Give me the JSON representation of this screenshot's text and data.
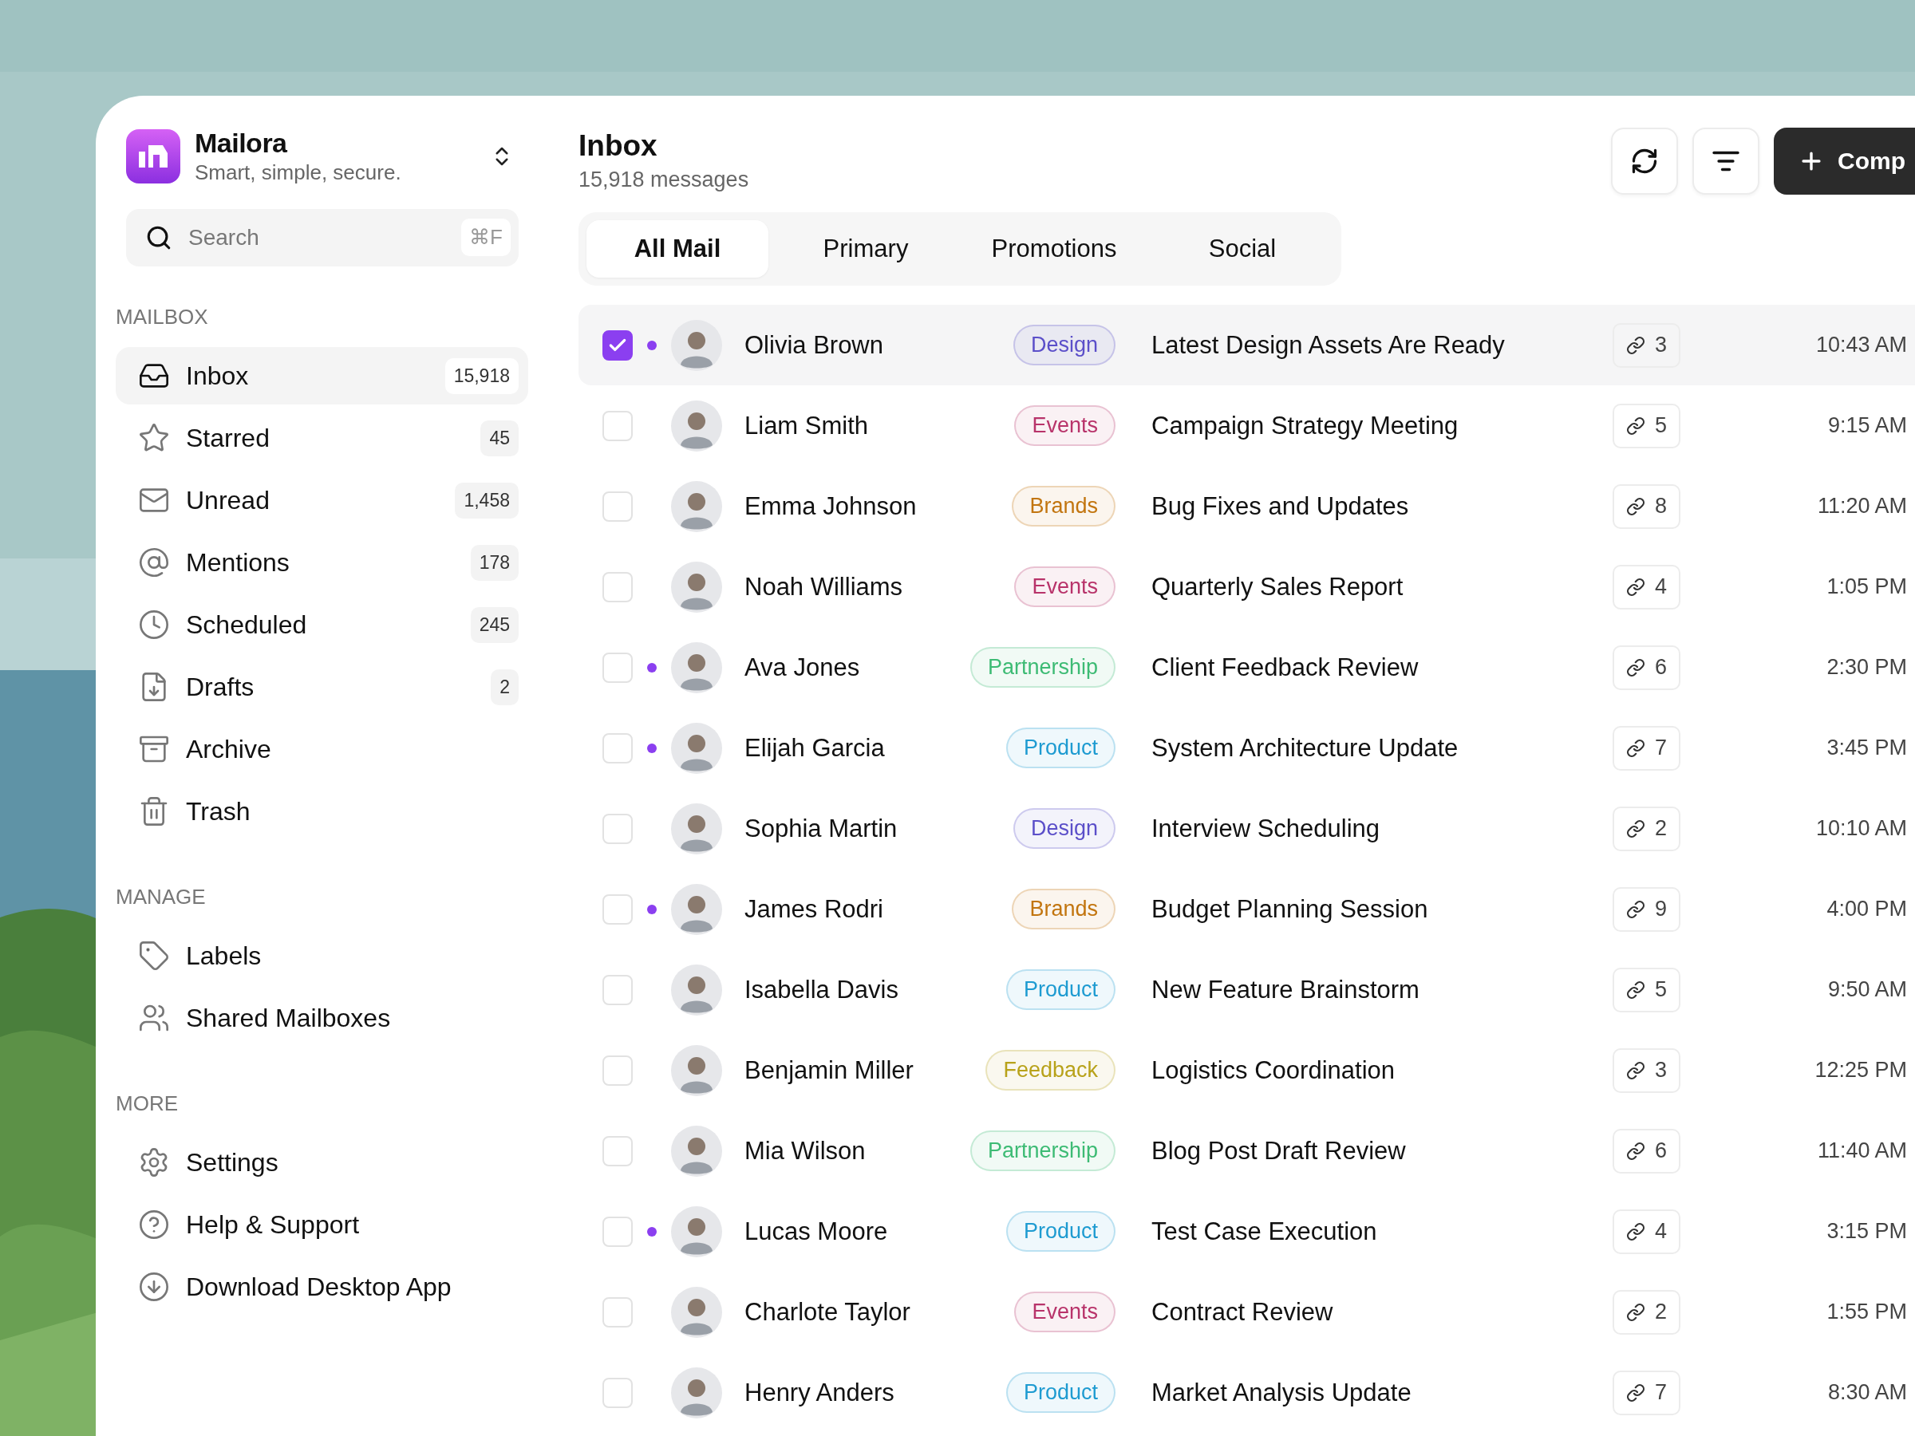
{
  "app": {
    "name": "Mailora",
    "tagline": "Smart, simple, secure."
  },
  "search": {
    "placeholder": "Search",
    "shortcut": "⌘F"
  },
  "sidebar": {
    "sections": [
      {
        "title": "MAILBOX",
        "items": [
          {
            "label": "Inbox",
            "count": "15,918",
            "selected": true
          },
          {
            "label": "Starred",
            "count": "45",
            "selected": false
          },
          {
            "label": "Unread",
            "count": "1,458",
            "selected": false
          },
          {
            "label": "Mentions",
            "count": "178",
            "selected": false
          },
          {
            "label": "Scheduled",
            "count": "245",
            "selected": false
          },
          {
            "label": "Drafts",
            "count": "2",
            "selected": false
          },
          {
            "label": "Archive",
            "selected": false
          },
          {
            "label": "Trash",
            "selected": false
          }
        ]
      },
      {
        "title": "MANAGE",
        "items": [
          {
            "label": "Labels",
            "selected": false
          },
          {
            "label": "Shared Mailboxes",
            "selected": false
          }
        ]
      },
      {
        "title": "MORE",
        "items": [
          {
            "label": "Settings",
            "selected": false
          },
          {
            "label": "Help & Support",
            "selected": false
          },
          {
            "label": "Download Desktop App",
            "selected": false
          }
        ]
      }
    ]
  },
  "header": {
    "title": "Inbox",
    "subtitle": "15,918 messages",
    "compose_label": "Comp"
  },
  "tabs": [
    {
      "label": "All Mail",
      "selected": true
    },
    {
      "label": "Primary",
      "selected": false
    },
    {
      "label": "Promotions",
      "selected": false
    },
    {
      "label": "Social",
      "selected": false
    }
  ],
  "messages": [
    {
      "sender": "Olivia Brown",
      "tag": {
        "label": "Design",
        "color": "#5b4fc9"
      },
      "subject": "Latest Design Assets Are Ready",
      "links": "3",
      "time": "10:43 AM",
      "checked": true,
      "unread": true
    },
    {
      "sender": "Liam Smith",
      "tag": {
        "label": "Events",
        "color": "#b8336a"
      },
      "subject": "Campaign Strategy Meeting",
      "links": "5",
      "time": "9:15 AM",
      "checked": false,
      "unread": false
    },
    {
      "sender": "Emma Johnson",
      "tag": {
        "label": "Brands",
        "color": "#c2750f"
      },
      "subject": "Bug Fixes and Updates",
      "links": "8",
      "time": "11:20 AM",
      "checked": false,
      "unread": false
    },
    {
      "sender": "Noah Williams",
      "tag": {
        "label": "Events",
        "color": "#b8336a"
      },
      "subject": "Quarterly Sales Report",
      "links": "4",
      "time": "1:05 PM",
      "checked": false,
      "unread": false
    },
    {
      "sender": "Ava Jones",
      "tag": {
        "label": "Partnership",
        "color": "#3dbb74"
      },
      "subject": "Client Feedback Review",
      "links": "6",
      "time": "2:30 PM",
      "checked": false,
      "unread": true
    },
    {
      "sender": "Elijah Garcia",
      "tag": {
        "label": "Product",
        "color": "#1e9bd1"
      },
      "subject": "System Architecture Update",
      "links": "7",
      "time": "3:45 PM",
      "checked": false,
      "unread": true
    },
    {
      "sender": "Sophia Martin",
      "tag": {
        "label": "Design",
        "color": "#5b4fc9"
      },
      "subject": "Interview Scheduling",
      "links": "2",
      "time": "10:10 AM",
      "checked": false,
      "unread": false
    },
    {
      "sender": "James Rodri",
      "tag": {
        "label": "Brands",
        "color": "#c2750f"
      },
      "subject": "Budget Planning Session",
      "links": "9",
      "time": "4:00 PM",
      "checked": false,
      "unread": true
    },
    {
      "sender": "Isabella Davis",
      "tag": {
        "label": "Product",
        "color": "#1e9bd1"
      },
      "subject": "New Feature Brainstorm",
      "links": "5",
      "time": "9:50 AM",
      "checked": false,
      "unread": false
    },
    {
      "sender": "Benjamin Miller",
      "tag": {
        "label": "Feedback",
        "color": "#b8a21a"
      },
      "subject": "Logistics Coordination",
      "links": "3",
      "time": "12:25 PM",
      "checked": false,
      "unread": false
    },
    {
      "sender": "Mia Wilson",
      "tag": {
        "label": "Partnership",
        "color": "#3dbb74"
      },
      "subject": "Blog Post Draft Review",
      "links": "6",
      "time": "11:40 AM",
      "checked": false,
      "unread": false
    },
    {
      "sender": "Lucas Moore",
      "tag": {
        "label": "Product",
        "color": "#1e9bd1"
      },
      "subject": "Test Case Execution",
      "links": "4",
      "time": "3:15 PM",
      "checked": false,
      "unread": true
    },
    {
      "sender": "Charlote Taylor",
      "tag": {
        "label": "Events",
        "color": "#b8336a"
      },
      "subject": "Contract Review",
      "links": "2",
      "time": "1:55 PM",
      "checked": false,
      "unread": false
    },
    {
      "sender": "Henry Anders",
      "tag": {
        "label": "Product",
        "color": "#1e9bd1"
      },
      "subject": "Market Analysis Update",
      "links": "7",
      "time": "8:30 AM",
      "checked": false,
      "unread": false
    }
  ]
}
